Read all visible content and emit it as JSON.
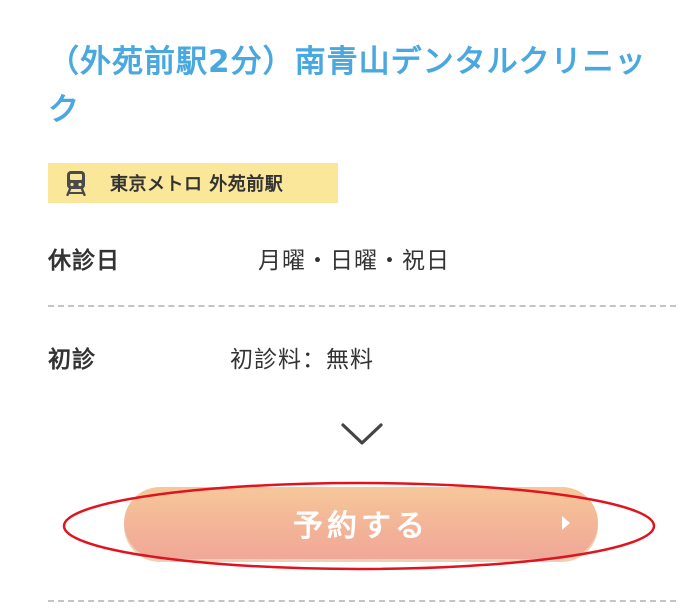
{
  "clinic": {
    "title": "（外苑前駅2分）南青山デンタルクリニック"
  },
  "station": {
    "icon": "train-icon",
    "label": "東京メトロ 外苑前駅"
  },
  "info": {
    "holiday_label": "休診日",
    "holiday_value": "月曜・日曜・祝日",
    "first_visit_label": "初診",
    "first_visit_value": "初診料：無料"
  },
  "expand": {
    "icon": "chevron-down-icon"
  },
  "reserve": {
    "label": "予約する",
    "icon": "caret-right-icon"
  },
  "colors": {
    "title": "#4aa8e0",
    "badge": "#fbe79a",
    "button": "#f3b497",
    "highlight": "#e0141e"
  }
}
